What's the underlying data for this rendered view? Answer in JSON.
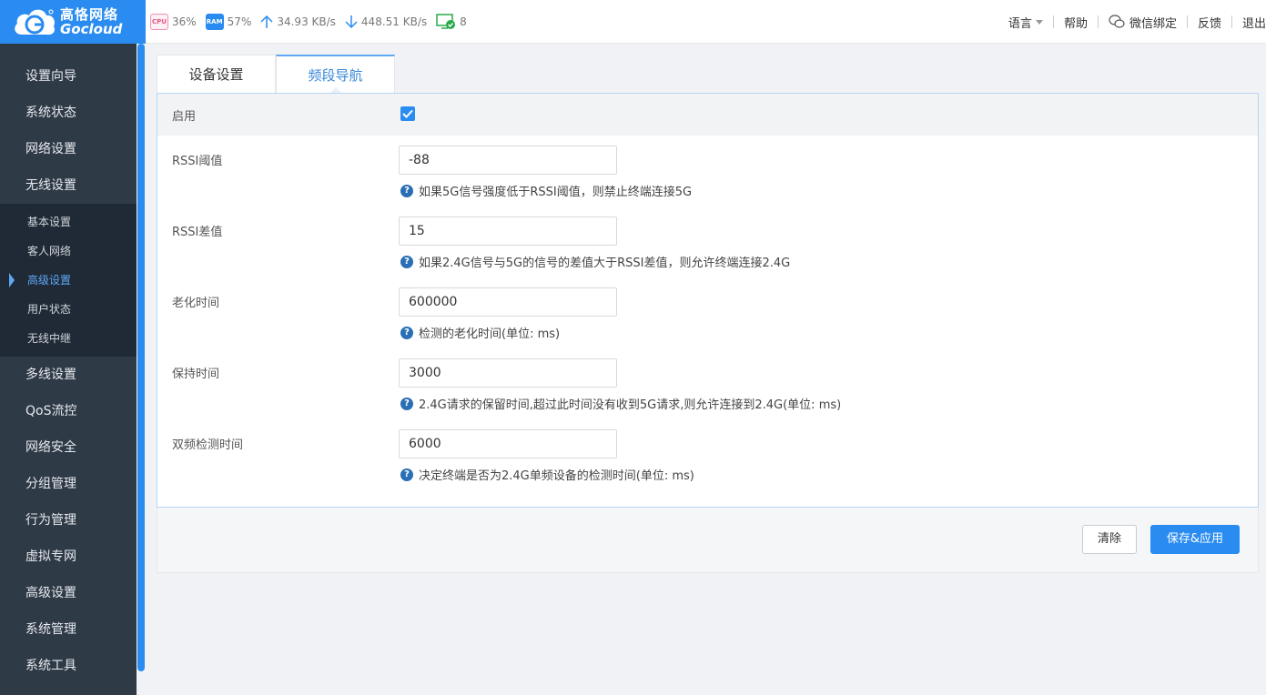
{
  "brand": {
    "name_cn": "高恪网络",
    "name_en": "Gocloud"
  },
  "stats": {
    "cpu_badge": "CPU",
    "cpu": "36%",
    "ram_badge": "RAM",
    "ram": "57%",
    "upload": "34.93 KB/s",
    "download": "448.51 KB/s",
    "devices": "8"
  },
  "topnav": {
    "language": "语言",
    "help": "帮助",
    "wechat": "微信绑定",
    "feedback": "反馈",
    "logout": "退出"
  },
  "sidebar": {
    "items_top": [
      "设置向导",
      "系统状态",
      "网络设置",
      "无线设置"
    ],
    "sub_items": [
      "基本设置",
      "客人网络",
      "高级设置",
      "用户状态",
      "无线中继"
    ],
    "active_sub_index": 2,
    "items_bottom": [
      "多线设置",
      "QoS流控",
      "网络安全",
      "分组管理",
      "行为管理",
      "虚拟专网",
      "高级设置",
      "系统管理",
      "系统工具"
    ]
  },
  "tabs": [
    {
      "label": "设备设置"
    },
    {
      "label": "频段导航"
    }
  ],
  "form": {
    "enable_label": "启用",
    "enabled": true,
    "fields": [
      {
        "label": "RSSI阈值",
        "value": "-88",
        "hint": "如果5G信号强度低于RSSI阈值，则禁止终端连接5G"
      },
      {
        "label": "RSSI差值",
        "value": "15",
        "hint": "如果2.4G信号与5G的信号的差值大于RSSI差值，则允许终端连接2.4G"
      },
      {
        "label": "老化时间",
        "value": "600000",
        "hint": "检测的老化时间(单位: ms)"
      },
      {
        "label": "保持时间",
        "value": "3000",
        "hint": "2.4G请求的保留时间,超过此时间没有收到5G请求,则允许连接到2.4G(单位: ms)"
      },
      {
        "label": "双频检测时间",
        "value": "6000",
        "hint": "决定终端是否为2.4G单频设备的检测时间(单位: ms)"
      }
    ]
  },
  "buttons": {
    "clear": "清除",
    "save": "保存&应用"
  },
  "colors": {
    "accent": "#2a8cf0",
    "sidebar_bg": "#2f3a47",
    "active_tab": "#3a88d8"
  }
}
